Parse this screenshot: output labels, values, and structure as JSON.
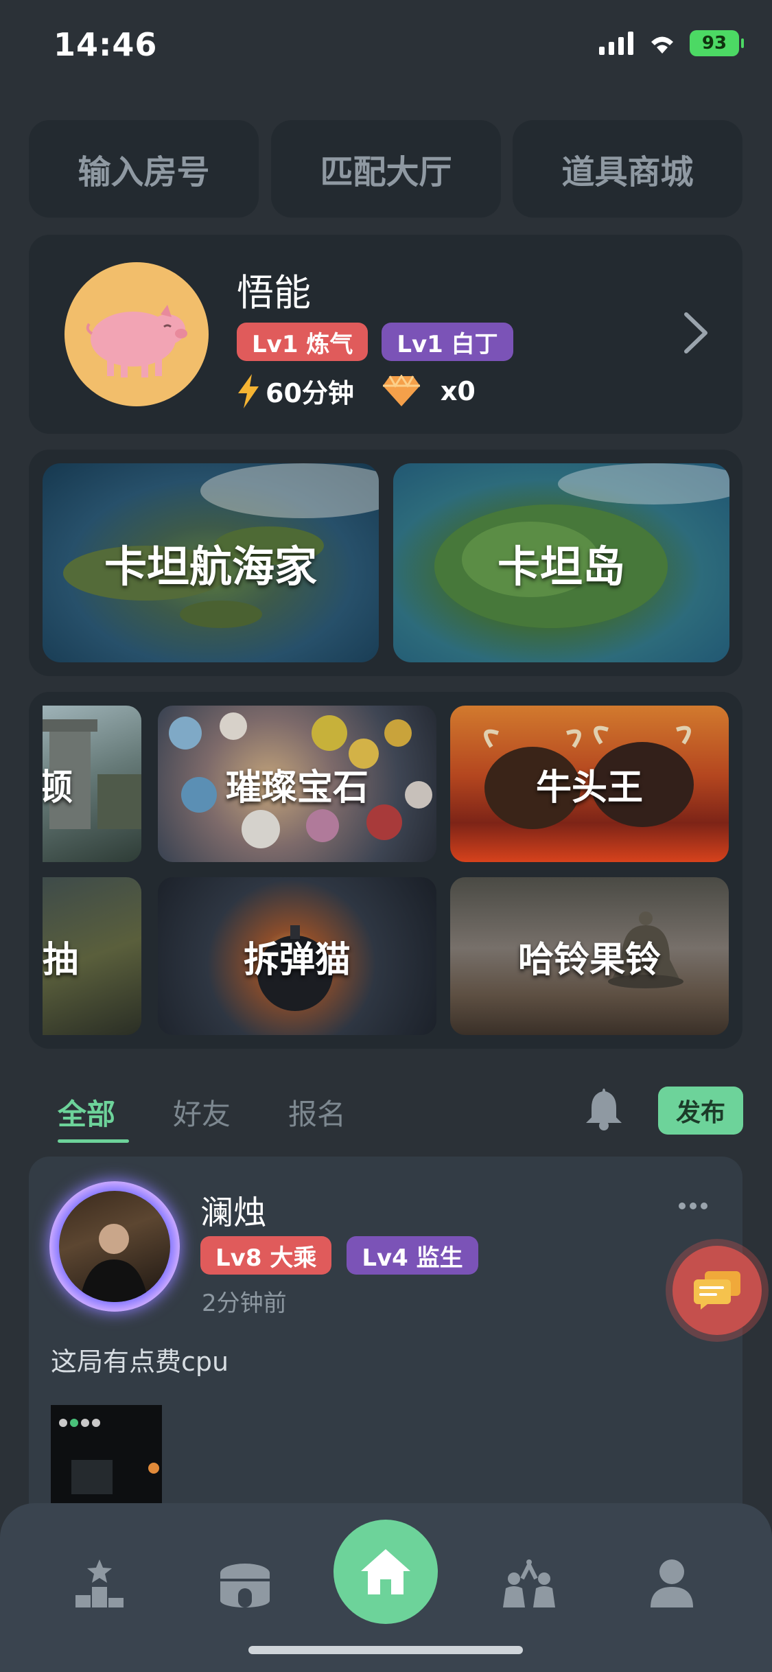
{
  "status_bar": {
    "time": "14:46",
    "battery": "93"
  },
  "top_buttons": [
    "输入房号",
    "匹配大厅",
    "道具商城"
  ],
  "profile": {
    "name": "悟能",
    "badges": [
      "Lv1 炼气",
      "Lv1 白丁"
    ],
    "energy": "60分钟",
    "gems": "x0"
  },
  "featured_games": [
    "卡坦航海家",
    "卡坦岛"
  ],
  "game_grid": {
    "row1": [
      "顿",
      "璀璨宝石",
      "牛头王"
    ],
    "row2": [
      "抽",
      "拆弹猫",
      "哈铃果铃"
    ]
  },
  "feed_tabs": [
    "全部",
    "好友",
    "报名"
  ],
  "publish_label": "发布",
  "post": {
    "author": "澜烛",
    "badges": [
      "Lv8 大乘",
      "Lv4 监生"
    ],
    "time": "2分钟前",
    "text": "这局有点费cpu"
  },
  "nav": [
    "star-podium-icon",
    "arena-icon",
    "home-icon",
    "party-icon",
    "profile-icon"
  ],
  "colors": {
    "accent": "#6dd39a",
    "badge_red": "#e05b5b",
    "badge_purple": "#7b53b7",
    "background": "#2b3137"
  }
}
